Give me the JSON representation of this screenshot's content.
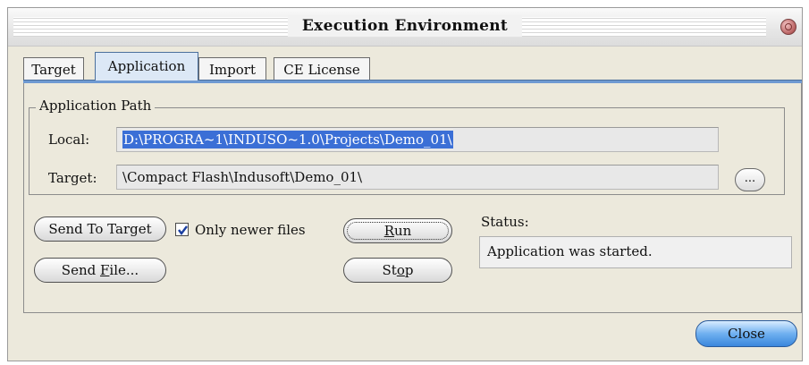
{
  "window": {
    "title": "Execution Environment"
  },
  "tabs": [
    {
      "label": "Target",
      "active": false
    },
    {
      "label": "Application",
      "active": true
    },
    {
      "label": "Import",
      "active": false
    },
    {
      "label": "CE License",
      "active": false
    }
  ],
  "application_path": {
    "group_label": "Application Path",
    "local_label": "Local:",
    "local_value": "D:\\PROGRA~1\\INDUSO~1.0\\Projects\\Demo_01\\",
    "target_label": "Target:",
    "target_value": "\\Compact Flash\\Indusoft\\Demo_01\\",
    "browse_label": "..."
  },
  "actions": {
    "send_to_target_label": "Send To Target",
    "only_newer_label": "Only newer files",
    "only_newer_checked": true,
    "send_file_label_pre": "Send ",
    "send_file_label_u": "F",
    "send_file_label_post": "ile...",
    "run_label_pre": "",
    "run_label_u": "R",
    "run_label_post": "un",
    "stop_label_pre": "St",
    "stop_label_u": "o",
    "stop_label_post": "p"
  },
  "status": {
    "label": "Status:",
    "text": "Application was started."
  },
  "footer": {
    "close_label": "Close"
  },
  "colors": {
    "accent": "#6f9ad2",
    "selection": "#3b6fd6"
  }
}
